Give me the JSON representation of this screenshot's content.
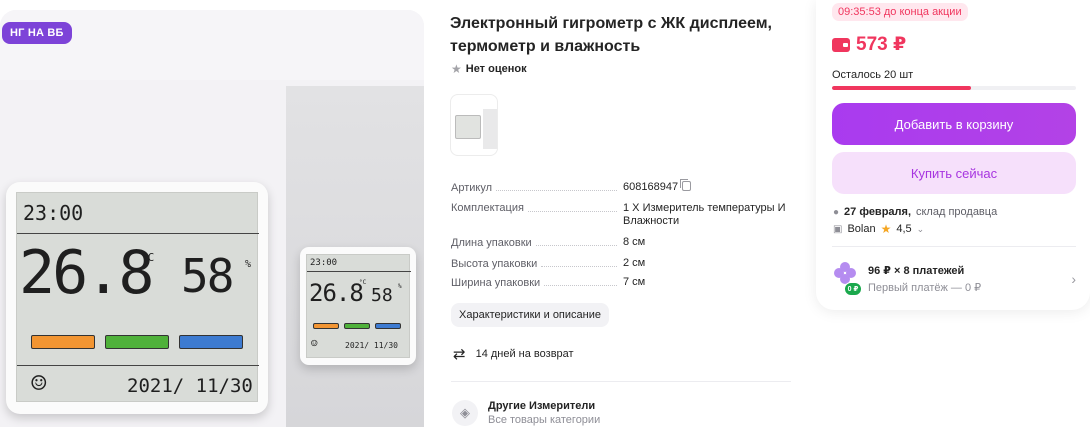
{
  "gallery": {
    "badge": "НГ НА ВБ"
  },
  "device_big": {
    "time": "23:00",
    "temp": "26.8",
    "temp_unit": "°C",
    "humidity": "58",
    "humidity_unit": "%",
    "date": "2021/ 11/30",
    "face": "☺"
  },
  "device_small": {
    "time": "23:00",
    "temp": "26.8",
    "temp_unit": "°C",
    "humidity": "58",
    "humidity_unit": "%",
    "date": "2021/ 11/30",
    "face": "☺"
  },
  "product": {
    "title": "Электронный гигрометр с ЖК дисплеем, термометр и влажность",
    "rating_text": "Нет оценок",
    "specs": [
      {
        "key": "Артикул",
        "value": "608168947"
      },
      {
        "key": "Комплектация",
        "value": "1 Х Измеритель температуры И Влажности"
      },
      {
        "key": "Длина упаковки",
        "value": "8 см"
      },
      {
        "key": "Высота упаковки",
        "value": "2 см"
      },
      {
        "key": "Ширина упаковки",
        "value": "7 см"
      }
    ],
    "description_chip": "Характеристики и описание",
    "returns": "14 дней на возврат",
    "category_title": "Другие Измерители",
    "category_sub": "Все товары категории"
  },
  "card": {
    "timer": "09:35:53 до конца акции",
    "price": "573 ₽",
    "stock": "Осталось 20 шт",
    "stock_progress": 0.57,
    "add_to_cart": "Добавить в корзину",
    "buy_now": "Купить сейчас",
    "delivery_date": "27 февраля,",
    "delivery_place": "склад продавца",
    "seller": "Bolan",
    "seller_rating": "4,5",
    "installment_title": "96 ₽ × 8 платежей",
    "installment_sub": "Первый платёж — 0 ₽",
    "installment_badge": "0 ₽"
  },
  "colors": {
    "accent": "#a93bef",
    "price": "#f0365e",
    "badge": "#7d43d8"
  },
  "icons": [
    "wallet-icon",
    "star-icon",
    "copy-icon",
    "return-arrows-icon",
    "category-icon",
    "truck-icon",
    "shop-icon",
    "installment-icon",
    "chevron-right-icon"
  ]
}
